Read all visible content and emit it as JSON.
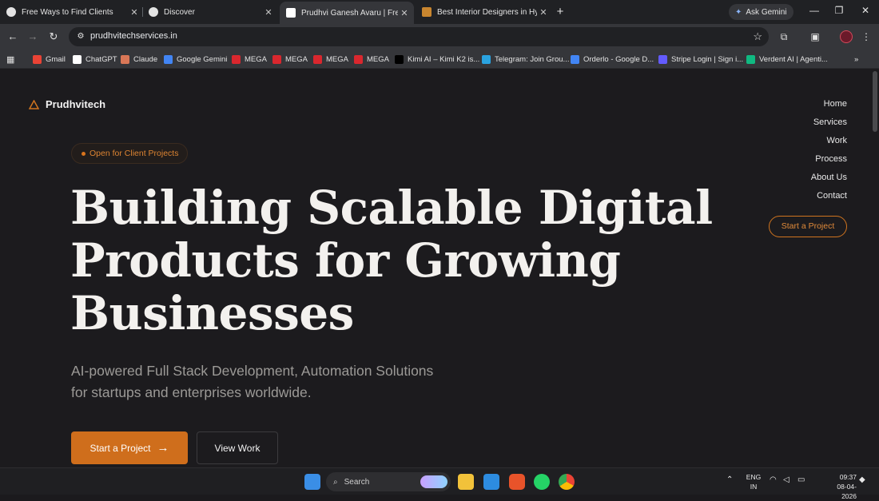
{
  "browser": {
    "tabs": [
      {
        "title": "Free Ways to Find Clients",
        "active": false
      },
      {
        "title": "Discover",
        "active": false
      },
      {
        "title": "Prudhvi Ganesh Avaru | Freelan",
        "active": true
      },
      {
        "title": "Best Interior Designers in Hyde",
        "active": false
      }
    ],
    "ask_gemini_label": "Ask Gemini",
    "url": "prudhvitechservices.in",
    "bookmarks": [
      {
        "label": "Gmail",
        "icon": "gmail-icon",
        "color": "#ea4335"
      },
      {
        "label": "ChatGPT",
        "icon": "chatgpt-icon",
        "color": "#ffffff"
      },
      {
        "label": "Claude",
        "icon": "claude-icon",
        "color": "#d97757"
      },
      {
        "label": "Google Gemini",
        "icon": "gemini-icon",
        "color": "#4285f4"
      },
      {
        "label": "MEGA",
        "icon": "mega-icon",
        "color": "#d9272e"
      },
      {
        "label": "MEGA",
        "icon": "mega-icon",
        "color": "#d9272e"
      },
      {
        "label": "MEGA",
        "icon": "mega-icon",
        "color": "#d9272e"
      },
      {
        "label": "MEGA",
        "icon": "mega-icon",
        "color": "#d9272e"
      },
      {
        "label": "Kimi AI – Kimi K2 is...",
        "icon": "kimi-icon",
        "color": "#000000"
      },
      {
        "label": "Telegram: Join Grou...",
        "icon": "telegram-icon",
        "color": "#2aa3e0"
      },
      {
        "label": "Orderlo - Google D...",
        "icon": "docs-icon",
        "color": "#4285f4"
      },
      {
        "label": "Stripe Login | Sign i...",
        "icon": "stripe-icon",
        "color": "#635bff"
      },
      {
        "label": "Verdent AI | Agenti...",
        "icon": "verdent-icon",
        "color": "#10b981"
      }
    ]
  },
  "site": {
    "brand": "Prudhvitech",
    "accent": "#d0741f",
    "nav": [
      "Home",
      "Services",
      "Work",
      "Process",
      "About Us",
      "Contact"
    ],
    "nav_cta": "Start a Project",
    "badge": "Open for Client Projects",
    "headline": [
      "Building Scalable Digital",
      "Products for Growing",
      "Businesses"
    ],
    "subtitle": [
      "AI-powered Full Stack Development, Automation Solutions",
      "for startups and enterprises worldwide."
    ],
    "primary_cta": "Start a Project",
    "secondary_cta": "View Work"
  },
  "taskbar": {
    "search_placeholder": "Search",
    "lang_line1": "ENG",
    "lang_line2": "IN",
    "time": "09:37",
    "date": "08-04-2026"
  }
}
